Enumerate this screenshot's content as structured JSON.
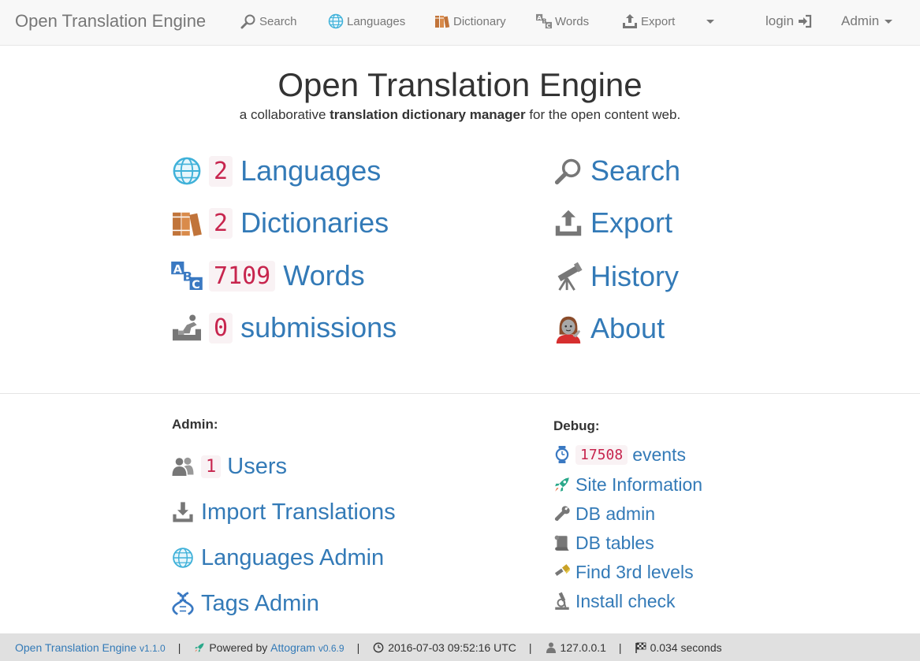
{
  "navbar": {
    "brand": "Open Translation Engine",
    "items": [
      {
        "label": "Search",
        "icon": "search-icon"
      },
      {
        "label": "Languages",
        "icon": "globe-icon"
      },
      {
        "label": "Dictionary",
        "icon": "books-icon"
      },
      {
        "label": "Words",
        "icon": "abc-icon"
      },
      {
        "label": "Export",
        "icon": "upload-icon"
      }
    ],
    "login": "login",
    "admin": "Admin"
  },
  "hero": {
    "title": "Open Translation Engine",
    "sub_prefix": "a collaborative ",
    "sub_bold": "translation dictionary manager",
    "sub_suffix": " for the open content web."
  },
  "stats": {
    "languages": {
      "count": "2",
      "label": "Languages"
    },
    "dictionaries": {
      "count": "2",
      "label": "Dictionaries"
    },
    "words": {
      "count": "7109",
      "label": "Words"
    },
    "submissions": {
      "count": "0",
      "label": "submissions"
    }
  },
  "links": {
    "search": "Search",
    "export": "Export",
    "history": "History",
    "about": "About"
  },
  "admin": {
    "label": "Admin:",
    "users": {
      "count": "1",
      "label": "Users"
    },
    "import": "Import Translations",
    "languages_admin": "Languages Admin",
    "tags_admin": "Tags Admin"
  },
  "debug": {
    "label": "Debug:",
    "events": {
      "count": "17508",
      "label": "events"
    },
    "site_info": "Site Information",
    "db_admin": "DB admin",
    "db_tables": "DB tables",
    "find_levels": "Find 3rd levels",
    "install_check": "Install check"
  },
  "footer": {
    "app_name": "Open Translation Engine",
    "app_version": "v1.1.0",
    "powered_by": "Powered by",
    "framework": "Attogram",
    "framework_version": "v0.6.9",
    "timestamp": "2016-07-03 09:52:16 UTC",
    "ip": "127.0.0.1",
    "timing": "0.034 seconds"
  },
  "colors": {
    "link": "#337ab7",
    "code_text": "#c7254e",
    "code_bg": "#f9f2f4",
    "navbar_bg": "#f8f8f8",
    "footer_bg": "#e0e0e0"
  }
}
